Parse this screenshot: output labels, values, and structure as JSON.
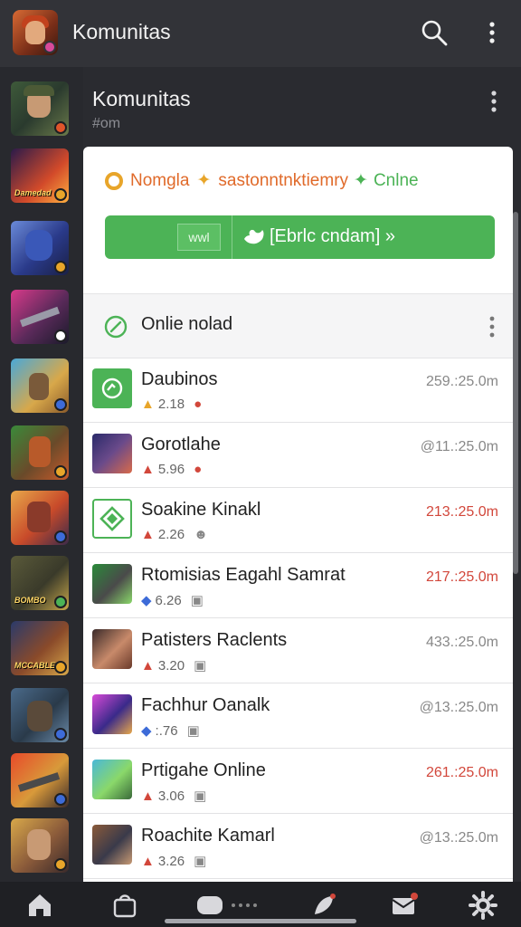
{
  "app_bar": {
    "title": "Komunitas",
    "search_icon": "search-icon",
    "menu_icon": "more-vertical-icon"
  },
  "header": {
    "title": "Komunitas",
    "subtitle": "#om"
  },
  "left_rail": {
    "items": [
      {
        "caption": "Damedad",
        "badge_color": "#e0552b"
      },
      {
        "caption": "",
        "badge_color": "#e8a52a"
      },
      {
        "caption": "",
        "badge_color": "#ffffff"
      },
      {
        "caption": "",
        "badge_color": "#3d6bd8"
      },
      {
        "caption": "",
        "badge_color": "#e8a52a"
      },
      {
        "caption": "",
        "badge_color": "#3d6bd8"
      },
      {
        "caption": "BOMBO",
        "badge_color": "#4cb356"
      },
      {
        "caption": "MCCABLE",
        "badge_color": "#e8a52a"
      },
      {
        "caption": "",
        "badge_color": "#3d6bd8"
      },
      {
        "caption": "",
        "badge_color": "#3d6bd8"
      },
      {
        "caption": "",
        "badge_color": "#e8a52a"
      }
    ]
  },
  "panel": {
    "status": {
      "part1": "Nomgla",
      "part2": "sastonntnktiemry",
      "part3": "Cnlne",
      "color_orange": "#e06a2a",
      "color_green": "#4cb356"
    },
    "green_button": {
      "box_text": "wwl",
      "label": "[Ebrlc cndam] »",
      "color": "#4cb356"
    },
    "section": {
      "label": "Onlie nolad"
    },
    "rows": [
      {
        "name": "Daubinos",
        "meta": "2.18",
        "time": "259.:25.0m",
        "time_red": false
      },
      {
        "name": "Gorotlahe",
        "meta": "5.96",
        "time": "@11.:25.0m",
        "time_red": false
      },
      {
        "name": "Soakine Kinakl",
        "meta": "2.26",
        "time": "213.:25.0m",
        "time_red": true
      },
      {
        "name": "Rtomisias Eagahl Samrat",
        "meta": "6.26",
        "time": "217.:25.0m",
        "time_red": true
      },
      {
        "name": "Patisters Raclents",
        "meta": "3.20",
        "time": "433.:25.0m",
        "time_red": false
      },
      {
        "name": "Fachhur Oanalk",
        "meta": ":.76",
        "time": "@13.:25.0m",
        "time_red": false
      },
      {
        "name": "Prtigahe Online",
        "meta": "3.06",
        "time": "261.:25.0m",
        "time_red": true
      },
      {
        "name": "Roachite Kamarl",
        "meta": "3.26",
        "time": "@13.:25.0m",
        "time_red": false
      }
    ]
  },
  "bottom_nav": {
    "items": [
      "home-icon",
      "bag-icon",
      "controller-icon",
      "feather-icon",
      "inbox-icon",
      "settings-icon"
    ]
  }
}
